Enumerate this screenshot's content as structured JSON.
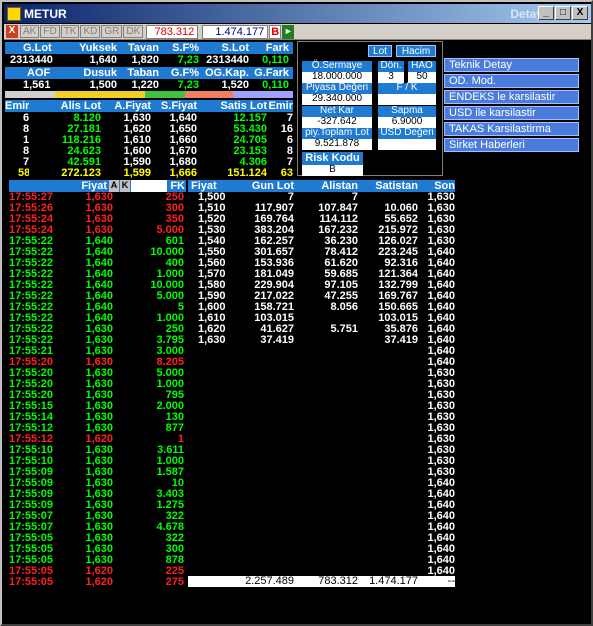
{
  "window": {
    "title": "METUR",
    "subtitle": "Detay",
    "min": "_",
    "max": "□",
    "close": "X"
  },
  "toolbar": {
    "close": "X",
    "buttons": [
      "AK",
      "FD",
      "TK",
      "KD",
      "GR",
      "DK"
    ],
    "value1": "783.312",
    "value2": "1.474.177",
    "b_label": "B",
    "arrow": "►"
  },
  "stats1": {
    "headers": [
      "G.Lot",
      "Yuksek",
      "Tavan",
      "S.F%",
      "S.Lot",
      "Fark"
    ],
    "values": [
      "2313440",
      "1,640",
      "1,820",
      "7,23",
      "2313440",
      "0,110"
    ]
  },
  "stats2": {
    "headers": [
      "AOF",
      "Dusuk",
      "Taban",
      "G.F%",
      "OG.Kap.",
      "G.Fark"
    ],
    "values": [
      "1,561",
      "1,500",
      "1,220",
      "7,23",
      "1,520",
      "0,110"
    ]
  },
  "depth": {
    "headers": [
      "Emir",
      "Alis Lot",
      "A.Fiyat",
      "S.Fiyat",
      "Satis Lot",
      "Emir"
    ],
    "rows": [
      [
        "6",
        "8.120",
        "1,630",
        "1,640",
        "12.157",
        "7"
      ],
      [
        "8",
        "27.181",
        "1,620",
        "1,650",
        "53.430",
        "16"
      ],
      [
        "13",
        "118.216",
        "1,610",
        "1,660",
        "24.705",
        "6"
      ],
      [
        "8",
        "24.623",
        "1,600",
        "1,670",
        "23.153",
        "8"
      ],
      [
        "7",
        "42.591",
        "1,590",
        "1,680",
        "4.306",
        "7"
      ]
    ],
    "totals": [
      "58",
      "272.123",
      "1,599",
      "1,666",
      "151.124",
      "63"
    ]
  },
  "panel": {
    "lot_btn": "Lot",
    "hacim_btn": "Hacim",
    "osermaye_label": "Ö.Sermaye",
    "osermaye_value": "18.000.000",
    "don_label": "Dön.",
    "don_value": "3",
    "hao_label": "HAO",
    "hao_value": "50",
    "piyasa_label": "Piyasa Değeri",
    "piyasa_value": "29.340.000",
    "fk_label": "F / K",
    "fk_value": "",
    "netkar_label": "Net Kar",
    "netkar_value": "-327.642",
    "sapma_label": "Sapma",
    "sapma_value": "6.9000",
    "piy_label": "piy.Toplam Lot",
    "piy_value": "9.521.878",
    "usd_label": "USD Değeri",
    "usd_value": "",
    "risk_label": "Risk Kodu",
    "risk_value": "B"
  },
  "menu": [
    "Teknik Detay",
    "OD. Mod.",
    "ENDEKS le karsilastir",
    "USD ile karsilastir",
    "TAKAS Karsilastirma",
    "Sirket Haberleri"
  ],
  "trades": {
    "header_price": "Fiyat",
    "header_a": "A",
    "header_k": "K",
    "header_fk": "FK",
    "rows": [
      {
        "t": "17:55:27",
        "p": "1,630",
        "q": "250",
        "c": "r"
      },
      {
        "t": "17:55:26",
        "p": "1,630",
        "q": "300",
        "c": "r"
      },
      {
        "t": "17:55:24",
        "p": "1,630",
        "q": "350",
        "c": "r"
      },
      {
        "t": "17:55:24",
        "p": "1,630",
        "q": "5.000",
        "c": "r"
      },
      {
        "t": "17:55:22",
        "p": "1,640",
        "q": "601",
        "c": "g"
      },
      {
        "t": "17:55:22",
        "p": "1,640",
        "q": "10.000",
        "c": "g"
      },
      {
        "t": "17:55:22",
        "p": "1,640",
        "q": "400",
        "c": "g"
      },
      {
        "t": "17:55:22",
        "p": "1,640",
        "q": "1.000",
        "c": "g"
      },
      {
        "t": "17:55:22",
        "p": "1,640",
        "q": "10.000",
        "c": "g"
      },
      {
        "t": "17:55:22",
        "p": "1,640",
        "q": "5.000",
        "c": "g"
      },
      {
        "t": "17:55:22",
        "p": "1,640",
        "q": "5",
        "c": "g"
      },
      {
        "t": "17:55:22",
        "p": "1,640",
        "q": "1.000",
        "c": "g"
      },
      {
        "t": "17:55:22",
        "p": "1,630",
        "q": "250",
        "c": "g"
      },
      {
        "t": "17:55:22",
        "p": "1,630",
        "q": "3.795",
        "c": "g"
      },
      {
        "t": "17:55:21",
        "p": "1,630",
        "q": "3.000",
        "c": "g"
      },
      {
        "t": "17:55:20",
        "p": "1,630",
        "q": "8.205",
        "c": "r"
      },
      {
        "t": "17:55:20",
        "p": "1,630",
        "q": "5.000",
        "c": "g"
      },
      {
        "t": "17:55:20",
        "p": "1,630",
        "q": "1.000",
        "c": "g"
      },
      {
        "t": "17:55:20",
        "p": "1,630",
        "q": "795",
        "c": "g"
      },
      {
        "t": "17:55:15",
        "p": "1,630",
        "q": "2.000",
        "c": "g"
      },
      {
        "t": "17:55:14",
        "p": "1,630",
        "q": "130",
        "c": "g"
      },
      {
        "t": "17:55:12",
        "p": "1,630",
        "q": "877",
        "c": "g"
      },
      {
        "t": "17:55:12",
        "p": "1,620",
        "q": "1",
        "c": "r"
      },
      {
        "t": "17:55:10",
        "p": "1,630",
        "q": "3.611",
        "c": "g"
      },
      {
        "t": "17:55:10",
        "p": "1,630",
        "q": "1.000",
        "c": "g"
      },
      {
        "t": "17:55:09",
        "p": "1,630",
        "q": "1.587",
        "c": "g"
      },
      {
        "t": "17:55:09",
        "p": "1,630",
        "q": "10",
        "c": "g"
      },
      {
        "t": "17:55:09",
        "p": "1,630",
        "q": "3.403",
        "c": "g"
      },
      {
        "t": "17:55:09",
        "p": "1,630",
        "q": "1.275",
        "c": "g"
      },
      {
        "t": "17:55:07",
        "p": "1,630",
        "q": "322",
        "c": "g"
      },
      {
        "t": "17:55:07",
        "p": "1,630",
        "q": "4.678",
        "c": "g"
      },
      {
        "t": "17:55:05",
        "p": "1,630",
        "q": "322",
        "c": "g"
      },
      {
        "t": "17:55:05",
        "p": "1,630",
        "q": "300",
        "c": "g"
      },
      {
        "t": "17:55:05",
        "p": "1,630",
        "q": "878",
        "c": "g"
      },
      {
        "t": "17:55:05",
        "p": "1,620",
        "q": "225",
        "c": "r"
      },
      {
        "t": "17:55:05",
        "p": "1,620",
        "q": "275",
        "c": "r"
      }
    ]
  },
  "fiyat": {
    "headers": [
      "Fiyat",
      "Gun Lot",
      "Alistan",
      "Satistan"
    ],
    "rows": [
      [
        "1,500",
        "7",
        "7",
        ""
      ],
      [
        "1,510",
        "117.907",
        "107.847",
        "10.060"
      ],
      [
        "1,520",
        "169.764",
        "114.112",
        "55.652"
      ],
      [
        "1,530",
        "383.204",
        "167.232",
        "215.972"
      ],
      [
        "1,540",
        "162.257",
        "36.230",
        "126.027"
      ],
      [
        "1,550",
        "301.657",
        "78.412",
        "223.245"
      ],
      [
        "1,560",
        "153.936",
        "61.620",
        "92.316"
      ],
      [
        "1,570",
        "181.049",
        "59.685",
        "121.364"
      ],
      [
        "1,580",
        "229.904",
        "97.105",
        "132.799"
      ],
      [
        "1,590",
        "217.022",
        "47.255",
        "169.767"
      ],
      [
        "1,600",
        "158.721",
        "8.056",
        "150.665"
      ],
      [
        "1,610",
        "103.015",
        "",
        "103.015"
      ],
      [
        "1,620",
        "41.627",
        "5.751",
        "35.876"
      ],
      [
        "1,630",
        "37.419",
        "",
        "37.419"
      ]
    ],
    "totals": [
      "2.257.489",
      "783.312",
      "1.474.177",
      "--"
    ]
  },
  "son": {
    "header": "Son",
    "values": [
      "1,630",
      "1,630",
      "1,630",
      "1,630",
      "1,630",
      "1,640",
      "1,640",
      "1,640",
      "1,640",
      "1,640",
      "1,640",
      "1,640",
      "1,640",
      "1,640",
      "1,640",
      "1,640",
      "1,630",
      "1,630",
      "1,630",
      "1,630",
      "1,630",
      "1,630",
      "1,630",
      "1,630",
      "1,630",
      "1,630",
      "1,640",
      "1,640",
      "1,640",
      "1,640",
      "1,640",
      "1,640",
      "1,640",
      "1,640",
      "1,640",
      "1,640"
    ]
  }
}
